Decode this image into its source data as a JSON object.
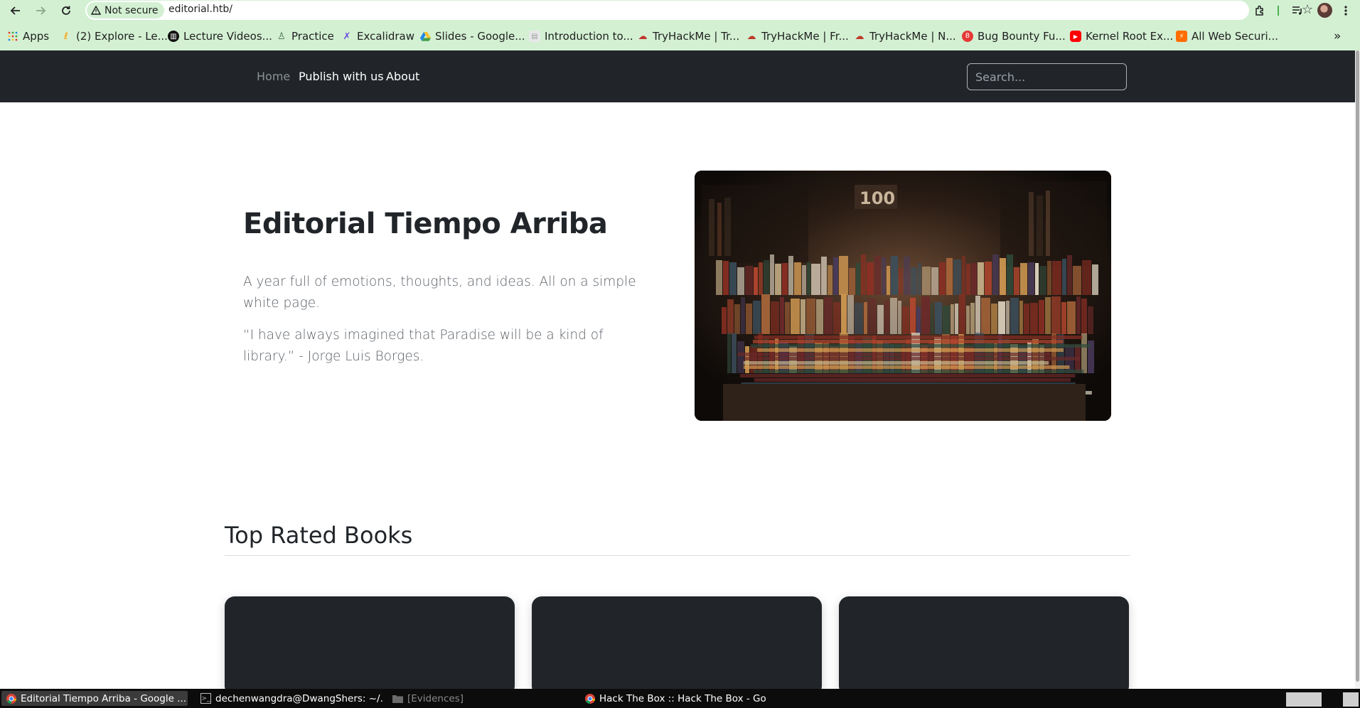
{
  "browser": {
    "security_label": "Not secure",
    "url": "editorial.htb/",
    "bookmarks": [
      {
        "label": "Apps",
        "icon": "apps-grid-icon"
      },
      {
        "label": "(2) Explore - Le...",
        "icon": "explore-icon"
      },
      {
        "label": "Lecture Videos...",
        "icon": "lecture-icon"
      },
      {
        "label": "Practice",
        "icon": "practice-icon"
      },
      {
        "label": "Excalidraw",
        "icon": "excalidraw-icon"
      },
      {
        "label": "Slides - Google...",
        "icon": "google-drive-icon"
      },
      {
        "label": "Introduction to...",
        "icon": "document-icon"
      },
      {
        "label": "TryHackMe | Tr...",
        "icon": "tryhackme-icon"
      },
      {
        "label": "TryHackMe | Fr...",
        "icon": "tryhackme-icon"
      },
      {
        "label": "TryHackMe | N...",
        "icon": "tryhackme-icon"
      },
      {
        "label": "Bug Bounty Fu...",
        "icon": "bug-bounty-icon"
      },
      {
        "label": "Kernel Root Ex...",
        "icon": "youtube-icon"
      },
      {
        "label": "All Web Securi...",
        "icon": "portswigger-icon"
      }
    ],
    "overflow_glyph": "»"
  },
  "site": {
    "nav": {
      "home": "Home",
      "publish": "Publish with us",
      "about": "About"
    },
    "search_placeholder": "Search...",
    "hero": {
      "title": "Editorial Tiempo Arriba",
      "tagline": "A year full of emotions, thoughts, and ideas. All on a simple white page.",
      "quote": "“I have always imagined that Paradise will be a kind of library.” - Jorge Luis Borges."
    },
    "section_title": "Top Rated Books",
    "book_cards": 3
  },
  "taskbar": {
    "tasks": [
      {
        "label": "Editorial Tiempo Arriba - Google ...",
        "icon": "chrome-icon",
        "active": true
      },
      {
        "label": "dechenwangdra@DwangShers: ~/...",
        "icon": "terminal-icon",
        "active": false
      },
      {
        "label": "[Evidences]",
        "icon": "folder-icon",
        "active": false
      },
      {
        "label": "Hack The Box :: Hack The Box - Go...",
        "icon": "chrome-icon",
        "active": false
      }
    ]
  },
  "colors": {
    "chrome_bg": "#d3f0d3",
    "site_nav_bg": "#212529",
    "heading": "#212529",
    "body_text": "#5b6168",
    "card_bg": "#212529"
  }
}
